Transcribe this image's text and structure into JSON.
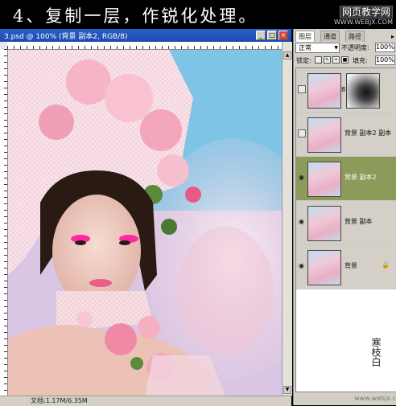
{
  "caption": "4、复制一层，作锐化处理。",
  "watermark": {
    "title": "网页教学网",
    "url": "WWW.WEBJX.COM"
  },
  "document": {
    "title": "3.psd @ 100% (背景 副本2, RGB/8)",
    "status": "文档:1.17M/6.35M",
    "buttons": {
      "minimize": "_",
      "maximize": "□",
      "close": "×"
    }
  },
  "panel": {
    "tabs": [
      "图层",
      "通道",
      "路径"
    ],
    "blend_mode": "正常",
    "opacity_label": "不透明度:",
    "opacity_value": "100%",
    "lock_label": "锁定:",
    "fill_label": "填充:",
    "fill_value": "100%",
    "layers": [
      {
        "name": "",
        "visible": false,
        "has_mask": true
      },
      {
        "name": "背景 副本2 副本",
        "visible": false
      },
      {
        "name": "背景 副本2",
        "visible": true,
        "selected": true
      },
      {
        "name": "背景 副本",
        "visible": true
      },
      {
        "name": "背景",
        "visible": true,
        "locked": true
      }
    ]
  },
  "signature": {
    "text": "寒枝白",
    "url": "www.webjx.com"
  },
  "colors": {
    "selected_layer": "#8c9a5a",
    "titlebar": "#2a5fc6"
  }
}
